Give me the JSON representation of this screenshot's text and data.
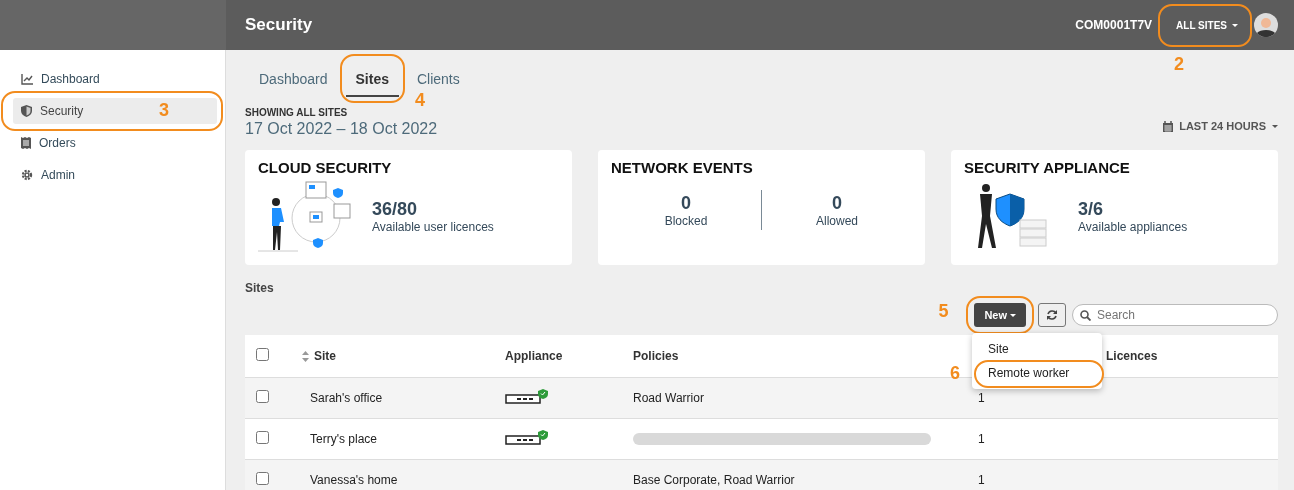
{
  "header": {
    "title": "Security",
    "account": "COM0001T7V",
    "site_picker": {
      "label": "ALL SITES",
      "callout": "2"
    }
  },
  "sidebar": {
    "items": [
      {
        "label": "Dashboard",
        "selected": false
      },
      {
        "label": "Security",
        "selected": true,
        "callout": "3"
      },
      {
        "label": "Orders",
        "selected": false
      },
      {
        "label": "Admin",
        "selected": false
      }
    ]
  },
  "tabs": [
    {
      "label": "Dashboard",
      "selected": false
    },
    {
      "label": "Sites",
      "selected": true,
      "callout": "4"
    },
    {
      "label": "Clients",
      "selected": false
    }
  ],
  "range": {
    "caption": "SHOWING ALL SITES",
    "dates": "17 Oct 2022 – 18 Oct 2022",
    "period": "LAST 24 HOURS"
  },
  "cards": [
    {
      "kind": "stat",
      "title": "CLOUD SECURITY",
      "value": "36/80",
      "caption": "Available user licences"
    },
    {
      "kind": "split",
      "title": "NETWORK EVENTS",
      "stats": [
        {
          "value": "0",
          "caption": "Blocked"
        },
        {
          "value": "0",
          "caption": "Allowed"
        }
      ]
    },
    {
      "kind": "stat",
      "title": "SECURITY APPLIANCE",
      "value": "3/6",
      "caption": "Available appliances"
    }
  ],
  "sites": {
    "heading": "Sites",
    "new_button": {
      "label": "New",
      "callout": "5"
    },
    "search": {
      "placeholder": "Search"
    },
    "menu": [
      {
        "label": "Site"
      },
      {
        "label": "Remote worker",
        "callout": "6"
      }
    ],
    "select_all": {
      "checked": false
    },
    "columns": [
      "Site",
      "Appliance",
      "Policies",
      "Licences"
    ],
    "rows": [
      {
        "checked": false,
        "site": "Sarah's office",
        "appliance": true,
        "policies": {
          "kind": "text",
          "text": "Road Warrior"
        },
        "column_4": "1"
      },
      {
        "checked": false,
        "site": "Terry's place",
        "appliance": true,
        "policies": {
          "kind": "loading"
        },
        "column_4": "1"
      },
      {
        "checked": false,
        "site": "Vanessa's home",
        "appliance": false,
        "policies": {
          "kind": "text",
          "text": "Base Corporate, Road Warrior"
        },
        "column_4": "1"
      }
    ]
  }
}
